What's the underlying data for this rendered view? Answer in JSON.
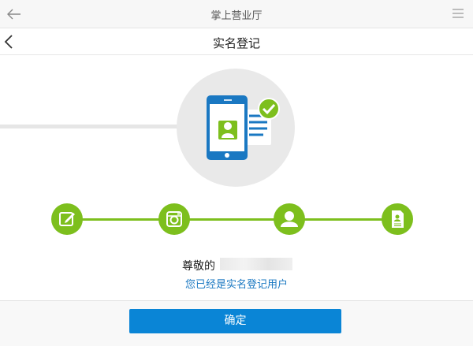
{
  "app": {
    "title": "掌上营业厅"
  },
  "page": {
    "title": "实名登记"
  },
  "steps": [
    {
      "icon": "edit-icon"
    },
    {
      "icon": "camera-icon"
    },
    {
      "icon": "user-icon"
    },
    {
      "icon": "document-icon"
    }
  ],
  "message": {
    "greeting": "尊敬的",
    "status": "您已经是实名登记用户"
  },
  "footer": {
    "confirm_label": "确定"
  },
  "colors": {
    "accent_green": "#7dbf1d",
    "button_blue": "#0a85d6",
    "link_blue": "#1a78c2"
  }
}
